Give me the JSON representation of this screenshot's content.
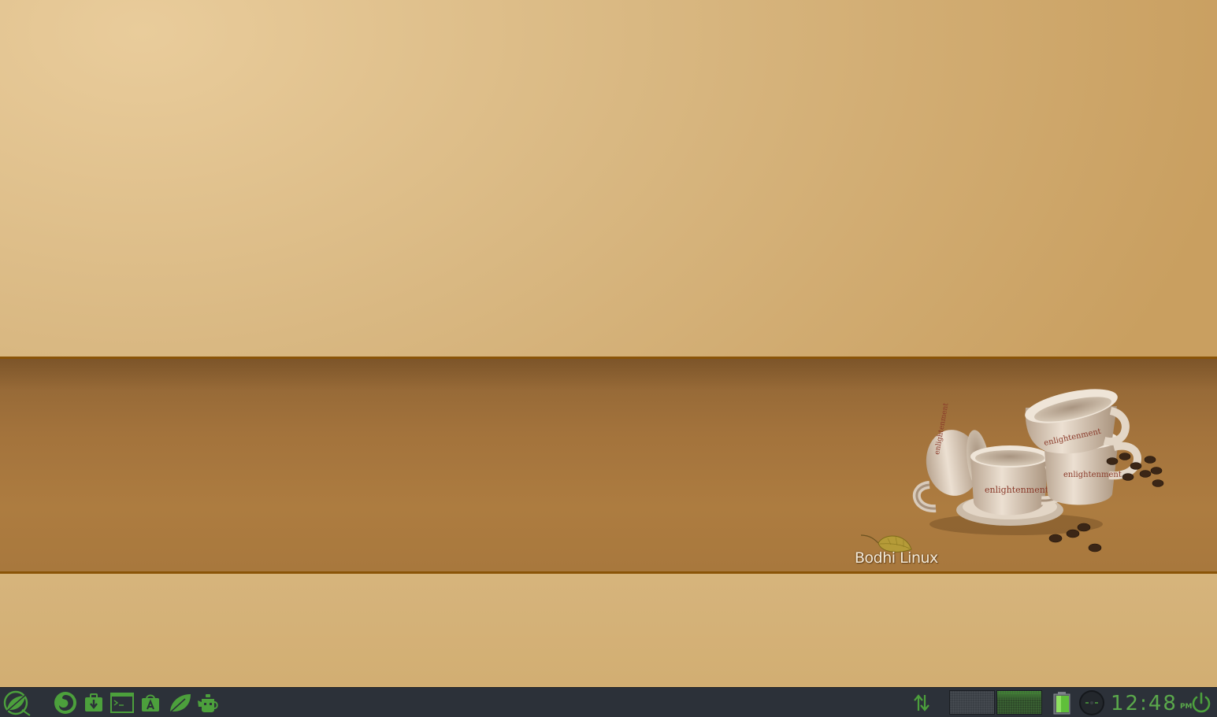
{
  "desktop": {
    "brand_text": "Bodhi Linux",
    "colors": {
      "wallpaper_light": "#e9cc9b",
      "wallpaper_band": "#a8783d",
      "band_border": "#8a5408"
    }
  },
  "taskbar": {
    "colors": {
      "background": "#2c3139",
      "accent": "#4ca03c"
    },
    "start_menu": {
      "icon": "bodhi-leaf-icon"
    },
    "launchers": [
      {
        "name": "Web Browser",
        "icon": "browser-icon"
      },
      {
        "name": "Package Installer",
        "icon": "package-installer-icon"
      },
      {
        "name": "Terminal",
        "icon": "terminal-icon"
      },
      {
        "name": "App Center",
        "icon": "app-store-icon"
      },
      {
        "name": "Bodhi Leaf",
        "icon": "leaf-icon"
      },
      {
        "name": "Software Manager",
        "icon": "teapot-icon"
      }
    ],
    "systray": {
      "network_icon": "network-arrows-icon",
      "pager": {
        "desktops": 2,
        "active_desktop": 2
      },
      "battery_icon": "battery-icon",
      "mixer_icon": "volume-knob-icon",
      "power_icon": "power-icon"
    },
    "clock": {
      "time": "12:48",
      "ampm": "PM"
    }
  }
}
